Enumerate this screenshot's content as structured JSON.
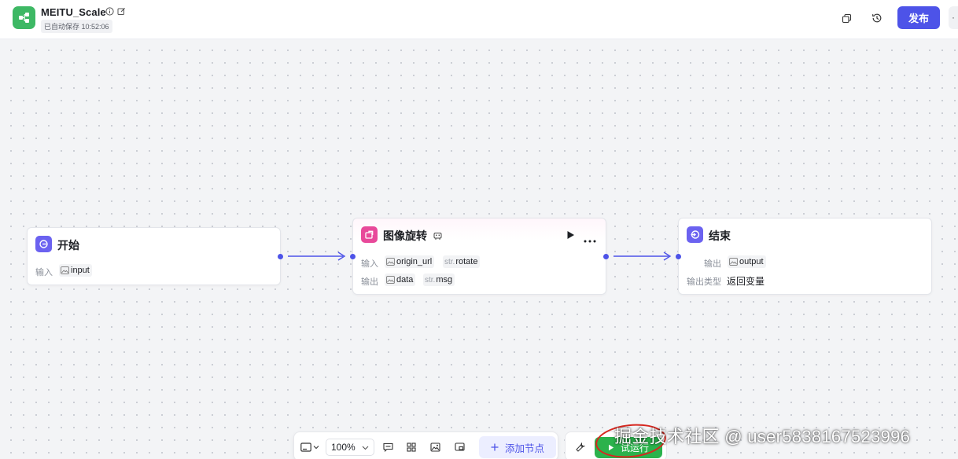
{
  "header": {
    "app_name": "MEITU_Scale",
    "autosave": "已自动保存 10:52:06",
    "publish_label": "发布",
    "icons": [
      "info-icon",
      "edit-icon",
      "copy-icon",
      "history-icon"
    ]
  },
  "nodes": {
    "start": {
      "title": "开始",
      "input_label": "输入",
      "input_var": "input"
    },
    "rotate": {
      "title": "图像旋转",
      "input_label": "输入",
      "output_label": "输出",
      "inputs": [
        {
          "prefix": "",
          "name": "origin_url"
        },
        {
          "prefix": "str.",
          "name": "rotate"
        }
      ],
      "outputs": [
        {
          "prefix": "",
          "name": "data"
        },
        {
          "prefix": "str.",
          "name": "msg"
        }
      ]
    },
    "end": {
      "title": "结束",
      "output_label": "输出",
      "output_var": "output",
      "output_type_label": "输出类型",
      "output_type_value": "返回变量"
    }
  },
  "toolbar": {
    "zoom": "100%",
    "add_node_label": "添加节点",
    "test_run_label": "试运行"
  },
  "watermark": "掘金技术社区 @ user5838167523996",
  "colors": {
    "accent": "#4d53e8",
    "run_green": "#2bb24c",
    "start_icon": "#6b62f0",
    "rotate_icon": "#e8499a",
    "end_icon": "#6b62f0",
    "annotation_red": "#d7271f"
  }
}
